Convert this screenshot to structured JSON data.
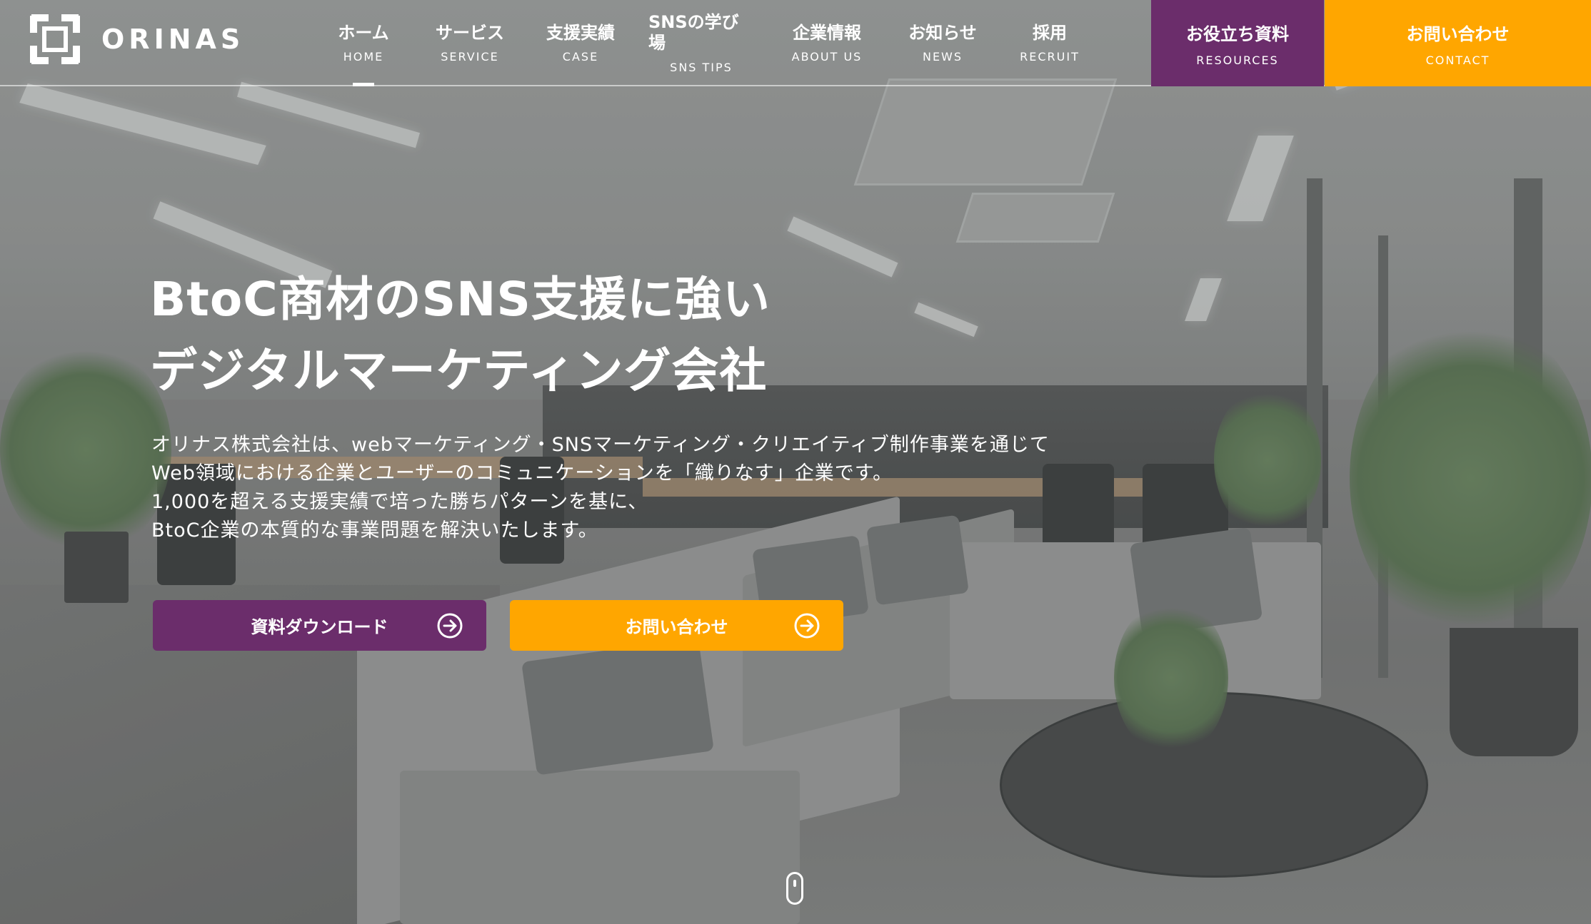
{
  "brand": {
    "name": "ORINAS",
    "logo_icon": "orinas-logo-icon"
  },
  "nav": {
    "items": [
      {
        "label": "ホーム",
        "sub": "HOME",
        "active": true
      },
      {
        "label": "サービス",
        "sub": "SERVICE"
      },
      {
        "label": "支援実績",
        "sub": "CASE"
      },
      {
        "label": "SNSの学び場",
        "sub": "SNS TIPS"
      },
      {
        "label": "企業情報",
        "sub": "ABOUT US"
      },
      {
        "label": "お知らせ",
        "sub": "NEWS"
      },
      {
        "label": "採用",
        "sub": "RECRUIT"
      }
    ],
    "resources": {
      "label": "お役立ち資料",
      "sub": "RESOURCES",
      "color": "#6b2d6b"
    },
    "contact": {
      "label": "お問い合わせ",
      "sub": "CONTACT",
      "color": "#ffa600"
    }
  },
  "hero": {
    "headline_line1": "BtoC商材のSNS支援に強い",
    "headline_line2": "デジタルマーケティング会社",
    "lead_line1": "オリナス株式会社は、webマーケティング・SNSマーケティング・クリエイティブ制作事業を通じて",
    "lead_line2": "Web領域における企業とユーザーのコミュニケーションを「織りなす」企業です。",
    "lead_line3": "1,000を超える支援実績で培った勝ちパターンを基に、",
    "lead_line4": "BtoC企業の本質的な事業問題を解決いたします。",
    "download_button": "資料ダウンロード",
    "contact_button": "お問い合わせ",
    "button_icon": "arrow-circle-right-icon",
    "scroll_icon": "mouse-scroll-icon"
  }
}
